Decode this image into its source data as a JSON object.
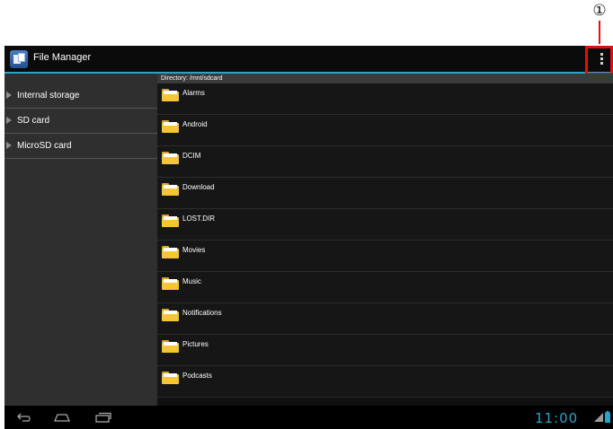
{
  "callout": {
    "number": "①"
  },
  "app": {
    "title": "File Manager"
  },
  "sidebar": {
    "items": [
      {
        "label": "Internal storage"
      },
      {
        "label": "SD card"
      },
      {
        "label": "MicroSD card"
      }
    ]
  },
  "content": {
    "directory": "Directory: /mnt/sdcard",
    "files": [
      {
        "name": "Alarms"
      },
      {
        "name": "Android"
      },
      {
        "name": "DCIM"
      },
      {
        "name": "Download"
      },
      {
        "name": "LOST.DIR"
      },
      {
        "name": "Movies"
      },
      {
        "name": "Music"
      },
      {
        "name": "Notifications"
      },
      {
        "name": "Pictures"
      },
      {
        "name": "Podcasts"
      }
    ]
  },
  "statusbar": {
    "time": "11:00"
  },
  "icons": {
    "app": "file-manager-icon",
    "overflow": "overflow-menu-icon",
    "folder": "folder-icon",
    "back": "back-icon",
    "home": "home-icon",
    "recent": "recent-apps-icon",
    "signal": "signal-icon",
    "battery": "battery-icon"
  },
  "colors": {
    "accent": "#2aa3c7",
    "highlight": "#e01010",
    "folder": "#f4c534"
  }
}
